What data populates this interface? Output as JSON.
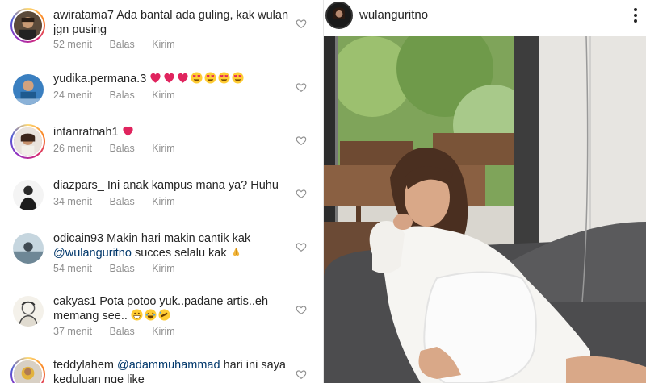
{
  "comments": [
    {
      "username": "awiratama7",
      "text": "Ada bantal ada guling, kak wulan jgn pusing",
      "time": "52 menit",
      "reply": "Balas",
      "send": "Kirim",
      "story_ring": true
    },
    {
      "username": "yudika.permana.3",
      "text": "",
      "emojis": [
        "red-heart",
        "red-heart",
        "red-heart",
        "heart-eyes",
        "heart-eyes",
        "heart-eyes",
        "heart-eyes"
      ],
      "time": "24 menit",
      "reply": "Balas",
      "send": "Kirim",
      "story_ring": false
    },
    {
      "username": "intanratnah1",
      "text": "",
      "emojis": [
        "red-heart"
      ],
      "time": "26 menit",
      "reply": "Balas",
      "send": "Kirim",
      "story_ring": true
    },
    {
      "username": "diazpars_",
      "text": "Ini anak kampus mana ya? Huhu",
      "time": "34 menit",
      "reply": "Balas",
      "send": "Kirim",
      "story_ring": false
    },
    {
      "username": "odicain93",
      "text": "Makin hari makin cantik kak",
      "mention": "@wulanguritno",
      "text_after": "succes selalu kak",
      "emojis": [
        "folded-hands"
      ],
      "time": "54 menit",
      "reply": "Balas",
      "send": "Kirim",
      "story_ring": false
    },
    {
      "username": "cakyas1",
      "text": "Pota potoo yuk..padane artis..eh memang see..",
      "emojis": [
        "grinning",
        "joy",
        "rofl"
      ],
      "time": "37 menit",
      "reply": "Balas",
      "send": "Kirim",
      "story_ring": false
    },
    {
      "username": "teddylahem",
      "mention": "@adammuhammad",
      "text_after": "hari ini saya keduluan nge like",
      "time": "",
      "reply": "",
      "send": "",
      "story_ring": true
    }
  ],
  "post": {
    "username": "wulanguritno",
    "more_icon": "more-vertical-icon"
  },
  "colors": {
    "mention": "#00376b",
    "meta": "#8e8e8e",
    "heart": "#e0245e"
  }
}
